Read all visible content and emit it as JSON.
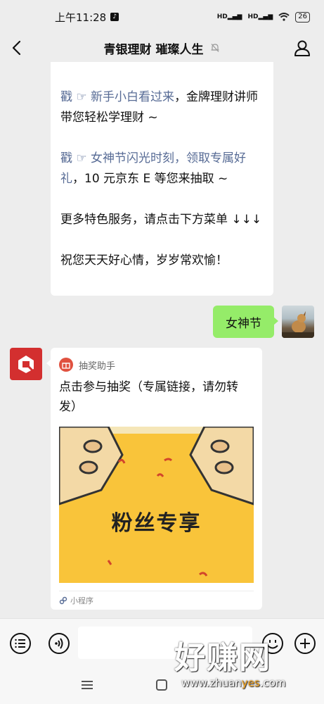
{
  "status_bar": {
    "time": "上午11:28",
    "signal_1": "HD",
    "signal_2": "HD",
    "battery": "26"
  },
  "header": {
    "title": "青银理财 璀璨人生"
  },
  "messages": {
    "received_text": {
      "line1_link": "戳 ☞ 新手小白看过来",
      "line1_rest": "，金牌理财讲师带您轻松学理财 ~",
      "line2_link": "戳 ☞ 女神节闪光时刻，领取专属好礼",
      "line2_rest": "，10 元京东 E 等您来抽取 ~",
      "line3": "更多特色服务，请点击下方菜单 ↓↓↓",
      "line4": "祝您天天好心情，岁岁常欢愉！"
    },
    "sent_text": "女神节",
    "mini_program": {
      "source_name": "抽奖助手",
      "title": "点击参与抽奖（专属链接，请勿转发）",
      "image_text": "粉丝专享",
      "footer_label": "小程序"
    }
  },
  "watermark": {
    "brand": "好赚网",
    "url_prefix": "www.zhuan",
    "url_highlight": "yes",
    "url_suffix": ".com"
  },
  "colors": {
    "sent_bubble": "#95ec69",
    "link": "#576b95",
    "chat_bg": "#ededed",
    "bot_avatar": "#d32f2f",
    "card_image": "#f9c43a"
  }
}
